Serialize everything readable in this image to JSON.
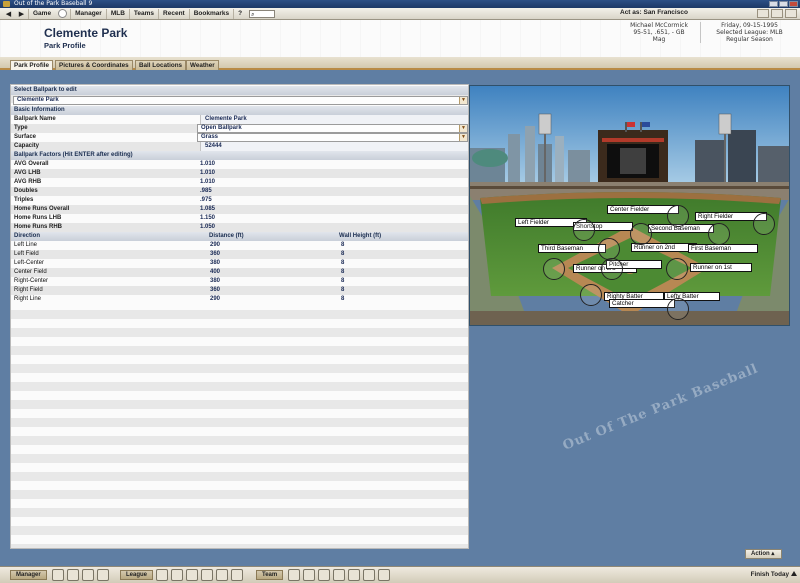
{
  "window": {
    "title": "Out of the Park Baseball 9"
  },
  "menubar": {
    "items": [
      "Game",
      "Manager",
      "MLB",
      "Teams",
      "Recent",
      "Bookmarks",
      "?"
    ],
    "act_as": "Act as: San Francisco"
  },
  "header": {
    "title": "Clemente Park",
    "subtitle": "Park Profile",
    "manager_name": "Michael McCormick",
    "manager_record": "95-51, .651, - GB",
    "manager_team": "Mag",
    "date": "Friday, 09-15-1995",
    "selected_league": "Selected League: MLB",
    "season_phase": "Regular Season"
  },
  "tabs": [
    "Park Profile",
    "Pictures & Coordinates",
    "Ball Locations",
    "Weather"
  ],
  "form": {
    "select_header": "Select Ballpark to edit",
    "selected_park": "Clemente Park",
    "basic_header": "Basic Information",
    "basic": [
      {
        "label": "Ballpark Name",
        "value": "Clemente Park"
      },
      {
        "label": "Type",
        "value": "Open Ballpark"
      },
      {
        "label": "Surface",
        "value": "Grass"
      },
      {
        "label": "Capacity",
        "value": "52444"
      }
    ],
    "factors_header": "Ballpark Factors (Hit ENTER after editing)",
    "factors": [
      {
        "label": "AVG Overall",
        "value": "1.010"
      },
      {
        "label": "AVG LHB",
        "value": "1.010"
      },
      {
        "label": "AVG RHB",
        "value": "1.010"
      },
      {
        "label": "Doubles",
        "value": ".985"
      },
      {
        "label": "Triples",
        "value": ".975"
      },
      {
        "label": "Home Runs Overall",
        "value": "1.085"
      },
      {
        "label": "Home Runs LHB",
        "value": "1.150"
      },
      {
        "label": "Home Runs RHB",
        "value": "1.050"
      }
    ],
    "dimensions_headers": {
      "direction": "Direction",
      "distance": "Distance (ft)",
      "wall": "Wall Height (ft)"
    },
    "dimensions": [
      {
        "direction": "Left Line",
        "distance": "290",
        "wall": "8"
      },
      {
        "direction": "Left Field",
        "distance": "360",
        "wall": "8"
      },
      {
        "direction": "Left-Center",
        "distance": "380",
        "wall": "8"
      },
      {
        "direction": "Center Field",
        "distance": "400",
        "wall": "8"
      },
      {
        "direction": "Right-Center",
        "distance": "380",
        "wall": "8"
      },
      {
        "direction": "Right Field",
        "distance": "360",
        "wall": "8"
      },
      {
        "direction": "Right Line",
        "distance": "290",
        "wall": "8"
      }
    ]
  },
  "ballpark_image": {
    "labels": [
      "Center Fielder",
      "Left Fielder",
      "Right Fielder",
      "Shortstop",
      "Second Baseman",
      "Third Baseman",
      "Runner on 2nd",
      "First Baseman",
      "Runner on 3rd",
      "Pitcher",
      "Runner on 1st",
      "Righty Batter",
      "Lefty Batter",
      "Catcher"
    ]
  },
  "bottom": {
    "manager_label": "Manager",
    "league_label": "League",
    "team_label": "Team",
    "action_label": "Action",
    "finish_label": "Finish Today"
  },
  "background_text": "Out Of The Park Baseball"
}
